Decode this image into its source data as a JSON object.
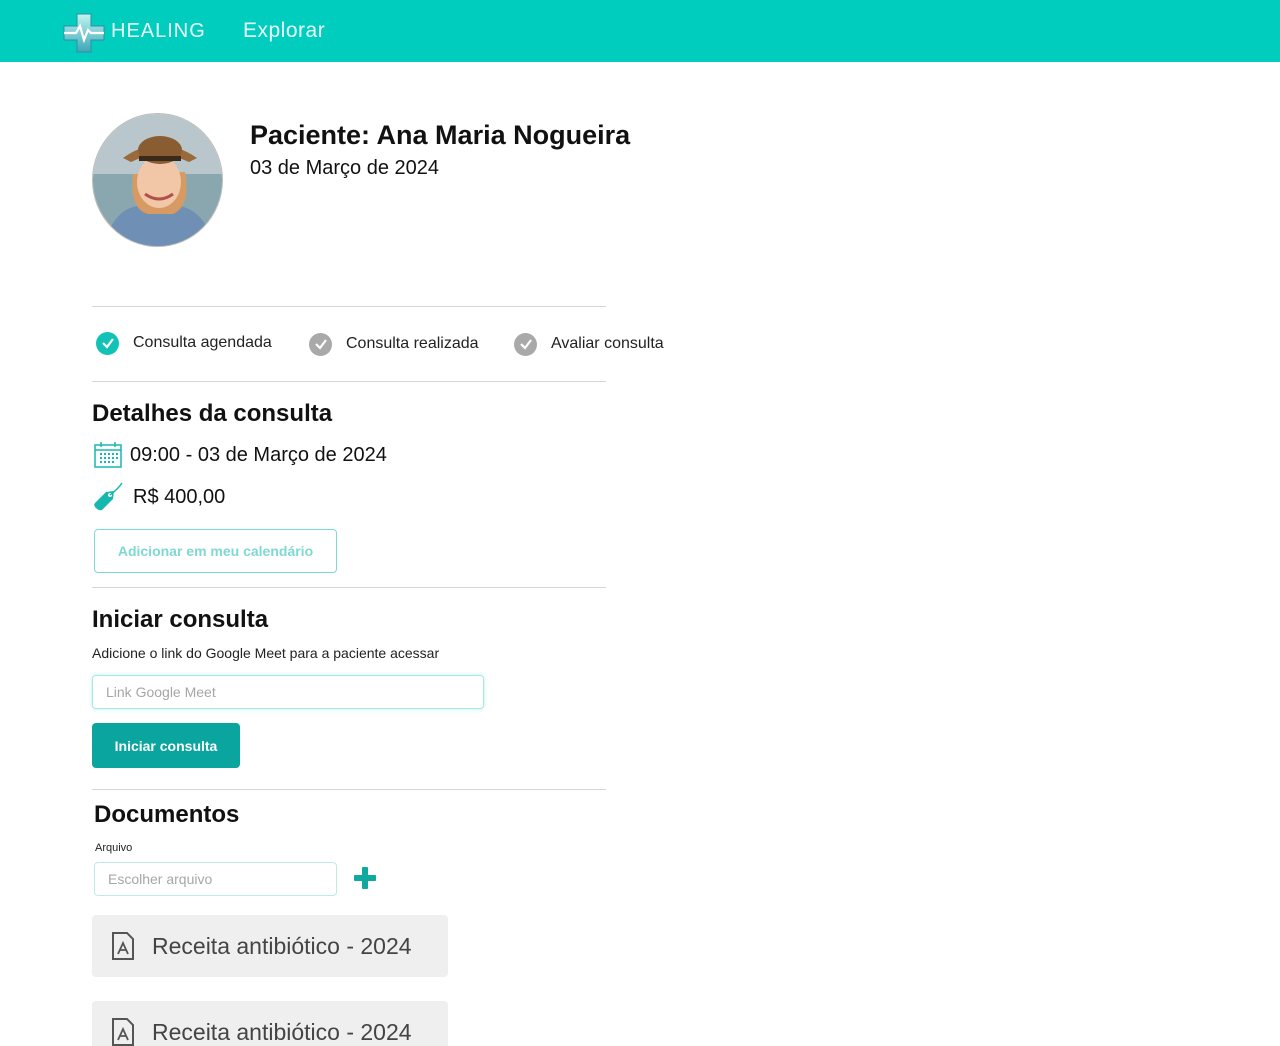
{
  "header": {
    "brand": "HEALING",
    "nav_explorar": "Explorar"
  },
  "patient": {
    "title": "Paciente: Ana Maria Nogueira",
    "date": "03 de Março de 2024"
  },
  "steps": [
    {
      "label": "Consulta agendada",
      "done": true
    },
    {
      "label": "Consulta realizada",
      "done": false
    },
    {
      "label": "Avaliar consulta",
      "done": false
    }
  ],
  "details": {
    "title": "Detalhes da consulta",
    "datetime": "09:00 - 03 de Março de 2024",
    "price": "R$ 400,00",
    "calendar_button": "Adicionar em meu calendário"
  },
  "start": {
    "title": "Iniciar consulta",
    "helper": "Adicione o link do Google Meet para a paciente acessar",
    "input_placeholder": "Link Google Meet",
    "button": "Iniciar consulta"
  },
  "documents": {
    "title": "Documentos",
    "file_label": "Arquivo",
    "file_placeholder": "Escolher arquivo",
    "items": [
      {
        "name": "Receita antibiótico - 2024"
      },
      {
        "name": "Receita antibiótico - 2024"
      }
    ]
  },
  "colors": {
    "header_bg": "#00cdbe",
    "accent": "#0aa59e",
    "step_done": "#13c2b6",
    "step_pending": "#a9a9a9"
  }
}
